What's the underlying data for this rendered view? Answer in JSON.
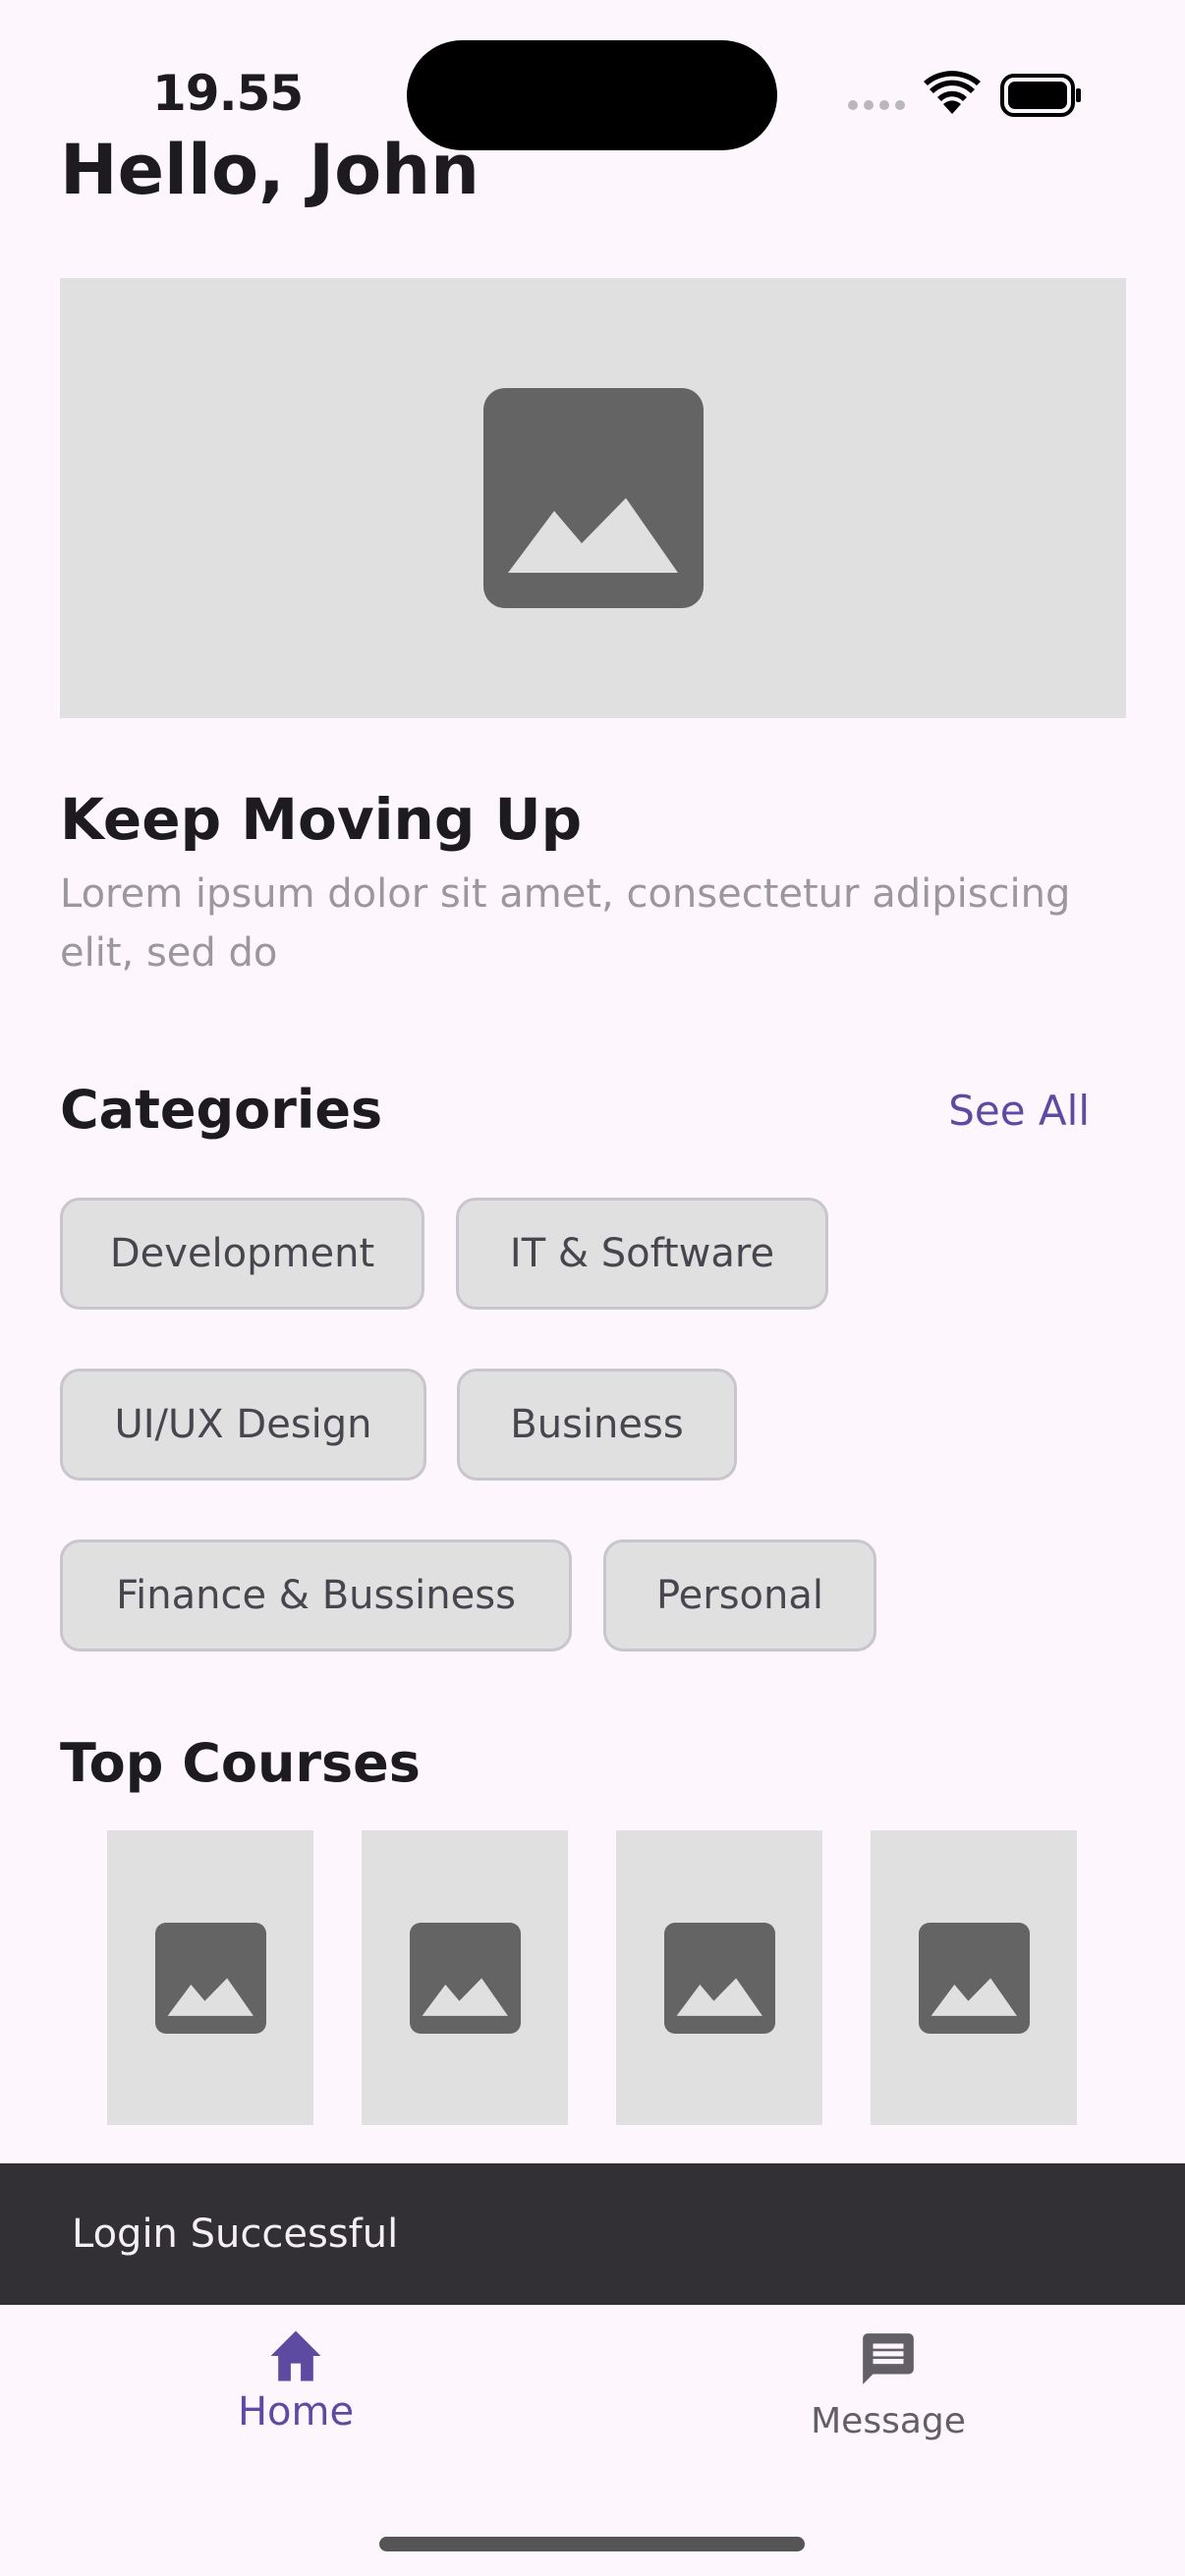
{
  "status": {
    "time": "19.55"
  },
  "greeting": "Hello, John",
  "hero": {
    "title": "Keep Moving Up",
    "subtitle": "Lorem ipsum dolor sit amet, consectetur adipiscing elit, sed do"
  },
  "categories": {
    "title": "Categories",
    "see_all": "See All",
    "items": [
      {
        "label": "Development"
      },
      {
        "label": "IT & Software"
      },
      {
        "label": "UI/UX Design"
      },
      {
        "label": "Business"
      },
      {
        "label": "Finance & Bussiness"
      },
      {
        "label": "Personal"
      }
    ]
  },
  "top_courses": {
    "title": "Top Courses",
    "count": 4
  },
  "snackbar": {
    "message": "Login Successful"
  },
  "nav": {
    "items": [
      {
        "label": "Home",
        "icon": "home-icon",
        "active": true
      },
      {
        "label": "Message",
        "icon": "message-icon",
        "active": false
      }
    ]
  },
  "colors": {
    "accent": "#5d4ba1",
    "background": "#fdf7fd",
    "placeholder": "#e0e0e0",
    "placeholder_icon": "#646464",
    "snackbar": "#323035"
  }
}
